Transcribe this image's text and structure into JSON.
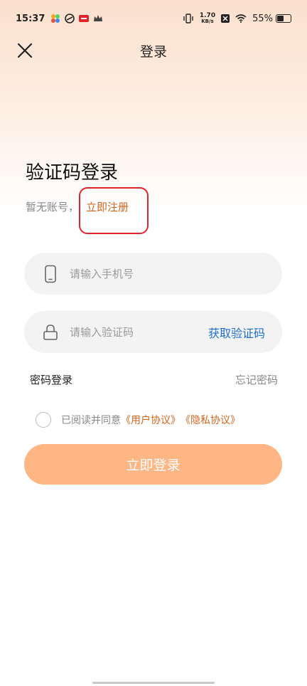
{
  "status_bar": {
    "time": "15:37",
    "speed_value": "1.70",
    "speed_unit": "KB/s",
    "battery": "55%",
    "battery_level": 0.55,
    "icons": [
      "app-icon-1",
      "app-icon-2",
      "app-icon-3",
      "crown-icon",
      "vibrate-icon",
      "x-icon",
      "wifi-icon",
      "battery-icon"
    ]
  },
  "nav": {
    "title": "登录"
  },
  "heading": "验证码登录",
  "register": {
    "prompt": "暂无账号，",
    "link": "立即注册"
  },
  "phone_field": {
    "placeholder": "请输入手机号",
    "value": ""
  },
  "code_field": {
    "placeholder": "请输入验证码",
    "value": "",
    "action": "获取验证码"
  },
  "links": {
    "password_login": "密码登录",
    "forgot_password": "忘记密码"
  },
  "agreement": {
    "prefix": "已阅读并同意",
    "user_agreement": "《用户协议》",
    "privacy_agreement": "《隐私协议》",
    "checked": false
  },
  "login_button": "立即登录",
  "colors": {
    "accent": "#d2651c",
    "link_blue": "#1d6fd1",
    "button": "#fdb684",
    "annotation": "#e0242a"
  }
}
